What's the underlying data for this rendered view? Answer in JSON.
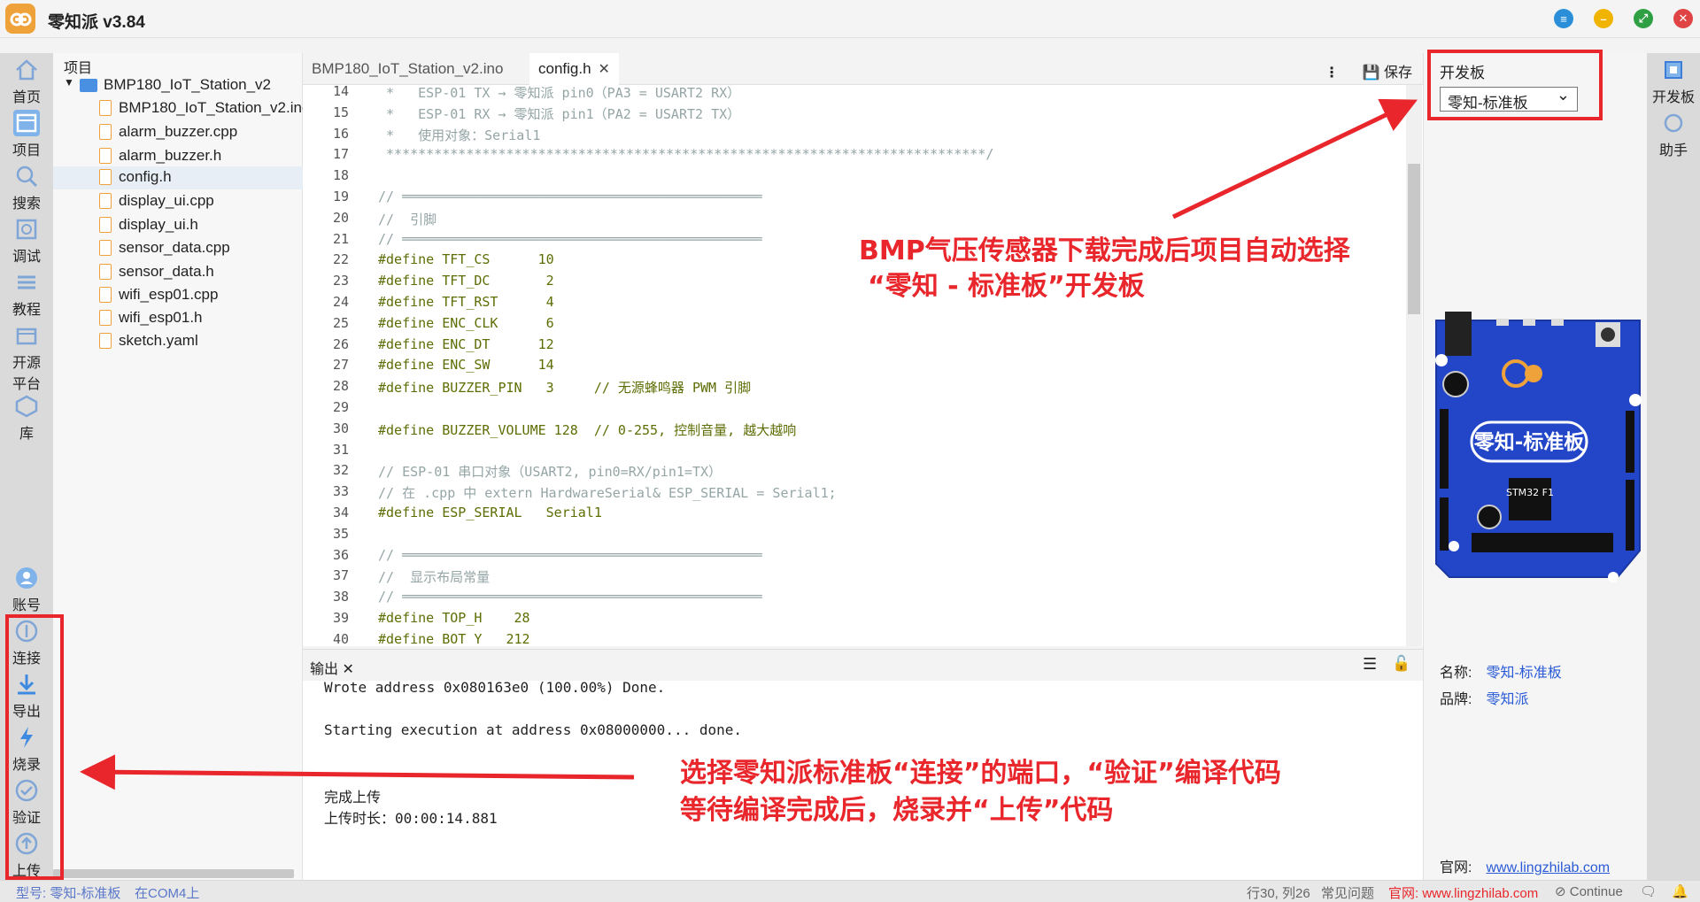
{
  "app": {
    "title": "零知派 v3.84"
  },
  "left_nav": [
    {
      "label": "首页",
      "icon": "home-icon"
    },
    {
      "label": "项目",
      "icon": "project-icon"
    },
    {
      "label": "搜索",
      "icon": "search-icon"
    },
    {
      "label": "调试",
      "icon": "debug-icon"
    },
    {
      "label": "教程",
      "icon": "tutorial-icon"
    },
    {
      "label1": "开源",
      "label2": "平台",
      "icon": "open-source-icon"
    },
    {
      "label": "库",
      "icon": "library-icon"
    },
    {
      "label": "账号",
      "icon": "account-icon"
    },
    {
      "label": "连接",
      "icon": "connect-icon"
    },
    {
      "label": "导出",
      "icon": "export-icon"
    },
    {
      "label": "烧录",
      "icon": "flash-icon"
    },
    {
      "label": "验证",
      "icon": "verify-icon"
    },
    {
      "label": "上传",
      "icon": "upload-icon"
    }
  ],
  "file_tree": {
    "header": "项目",
    "root": "BMP180_IoT_Station_v2",
    "files": [
      "BMP180_IoT_Station_v2.ino",
      "alarm_buzzer.cpp",
      "alarm_buzzer.h",
      "config.h",
      "display_ui.cpp",
      "display_ui.h",
      "sensor_data.cpp",
      "sensor_data.h",
      "wifi_esp01.cpp",
      "wifi_esp01.h",
      "sketch.yaml"
    ],
    "selected": "config.h"
  },
  "tabs": {
    "items": [
      "BMP180_IoT_Station_v2.ino",
      "config.h"
    ],
    "active": "config.h",
    "save": "保存",
    "more": "⋮"
  },
  "code_lines": [
    {
      "n": "14",
      "t": " *   ESP-01 TX → 零知派 pin0（PA3 = USART2 RX）",
      "k": "comment"
    },
    {
      "n": "15",
      "t": " *   ESP-01 RX → 零知派 pin1（PA2 = USART2 TX）",
      "k": "comment"
    },
    {
      "n": "16",
      "t": " *   使用对象：Serial1",
      "k": "comment"
    },
    {
      "n": "17",
      "t": " ***************************************************************************/",
      "k": "comment"
    },
    {
      "n": "18",
      "t": "",
      "k": "plain"
    },
    {
      "n": "19",
      "t": "// ═════════════════════════════════════════════",
      "k": "comment"
    },
    {
      "n": "20",
      "t": "//  引脚",
      "k": "comment"
    },
    {
      "n": "21",
      "t": "// ═════════════════════════════════════════════",
      "k": "comment"
    },
    {
      "n": "22",
      "t": "#define TFT_CS      10",
      "k": "define"
    },
    {
      "n": "23",
      "t": "#define TFT_DC       2",
      "k": "define"
    },
    {
      "n": "24",
      "t": "#define TFT_RST      4",
      "k": "define"
    },
    {
      "n": "25",
      "t": "#define ENC_CLK      6",
      "k": "define"
    },
    {
      "n": "26",
      "t": "#define ENC_DT      12",
      "k": "define"
    },
    {
      "n": "27",
      "t": "#define ENC_SW      14",
      "k": "define"
    },
    {
      "n": "28",
      "t": "#define BUZZER_PIN   3     // 无源蜂鸣器 PWM 引脚",
      "k": "define"
    },
    {
      "n": "29",
      "t": "",
      "k": "plain"
    },
    {
      "n": "30",
      "t": "#define BUZZER_VOLUME 128  // 0-255, 控制音量, 越大越响",
      "k": "define"
    },
    {
      "n": "31",
      "t": "",
      "k": "plain"
    },
    {
      "n": "32",
      "t": "// ESP-01 串口对象（USART2, pin0=RX/pin1=TX）",
      "k": "comment"
    },
    {
      "n": "33",
      "t": "// 在 .cpp 中 extern HardwareSerial& ESP_SERIAL = Serial1;",
      "k": "comment"
    },
    {
      "n": "34",
      "t": "#define ESP_SERIAL   Serial1",
      "k": "define"
    },
    {
      "n": "35",
      "t": "",
      "k": "plain"
    },
    {
      "n": "36",
      "t": "// ═════════════════════════════════════════════",
      "k": "comment"
    },
    {
      "n": "37",
      "t": "//  显示布局常量",
      "k": "comment"
    },
    {
      "n": "38",
      "t": "// ═════════════════════════════════════════════",
      "k": "comment"
    },
    {
      "n": "39",
      "t": "#define TOP_H    28",
      "k": "define"
    },
    {
      "n": "40",
      "t": "#define BOT_Y   212",
      "k": "define"
    }
  ],
  "output": {
    "tab": "输出",
    "lines": [
      "Wrote address 0x080163e0 (100.00%) Done.",
      "",
      "Starting execution at address 0x08000000... done.",
      "",
      "",
      "完成上传",
      "上传时长：00:00:14.881"
    ]
  },
  "board_panel": {
    "title": "开发板",
    "selected": "零知-标准板",
    "board_image_label": "零知-标准板",
    "chip_label": "STM32 F1",
    "name_label": "名称:",
    "name_value": "零知-标准板",
    "brand_label": "品牌:",
    "brand_value": "零知派",
    "site_label": "官网:",
    "site_value": "www.lingzhilab.com"
  },
  "right_nav": [
    {
      "label": "开发板",
      "icon": "board-icon"
    },
    {
      "label": "助手",
      "icon": "assistant-icon"
    }
  ],
  "status": {
    "model": "型号: 零知-标准板",
    "port": "在COM4上",
    "position": "行30, 列26",
    "faq": "常见问题",
    "site": "官网: www.lingzhilab.com",
    "continue": "Continue"
  },
  "annotations": {
    "top_line1": "BMP气压传感器下载完成后项目自动选择",
    "top_line2": "“零知 - 标准板”开发板",
    "bottom_line1": "选择零知派标准板“连接”的端口，“验证”编译代码",
    "bottom_line2": "等待编译完成后，烧录并“上传”代码"
  },
  "colors": {
    "accent": "#2a5bd7",
    "annotation": "#e8262b",
    "board_blue": "#2346c8"
  }
}
